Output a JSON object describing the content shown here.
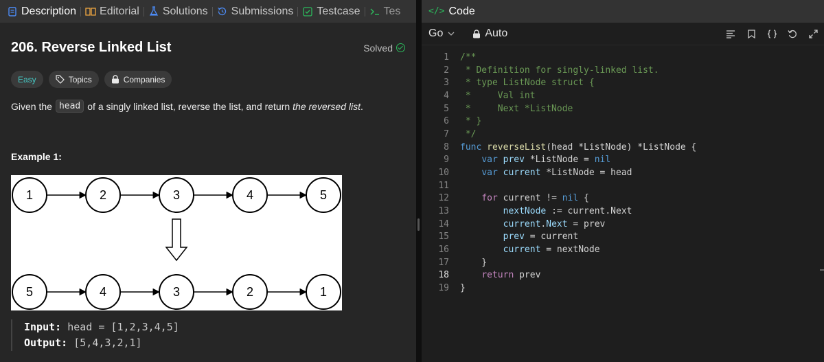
{
  "left_tabs": [
    {
      "label": "Description",
      "icon": "description-icon",
      "active": true
    },
    {
      "label": "Editorial",
      "icon": "book-icon",
      "active": false
    },
    {
      "label": "Solutions",
      "icon": "flask-icon",
      "active": false
    },
    {
      "label": "Submissions",
      "icon": "history-icon",
      "active": false
    },
    {
      "label": "Testcase",
      "icon": "checkbox-icon",
      "active": false
    },
    {
      "label": "Tes",
      "icon": "terminal-icon",
      "active": false
    }
  ],
  "problem": {
    "title": "206. Reverse Linked List",
    "status": "Solved",
    "difficulty": "Easy",
    "topics_label": "Topics",
    "companies_label": "Companies",
    "desc_before": "Given the",
    "desc_code": "head",
    "desc_middle": "of a singly linked list, reverse the list, and return",
    "desc_italic": "the reversed list",
    "desc_end": ".",
    "example_title": "Example 1:",
    "diagram_top": [
      "1",
      "2",
      "3",
      "4",
      "5"
    ],
    "diagram_bottom": [
      "5",
      "4",
      "3",
      "2",
      "1"
    ],
    "input_label": "Input:",
    "input_value": "head = [1,2,3,4,5]",
    "output_label": "Output:",
    "output_value": "[5,4,3,2,1]"
  },
  "code_panel": {
    "title": "Code",
    "language": "Go",
    "mode": "Auto",
    "current_line": 18,
    "line_numbers": [
      "1",
      "2",
      "3",
      "4",
      "5",
      "6",
      "7",
      "8",
      "9",
      "10",
      "11",
      "12",
      "13",
      "14",
      "15",
      "16",
      "17",
      "18",
      "19"
    ]
  },
  "colors": {
    "accent_green": "#2cbb5d",
    "easy_teal": "#46c6c2",
    "panel_bg": "#262626",
    "editor_bg": "#1e1e1e"
  }
}
